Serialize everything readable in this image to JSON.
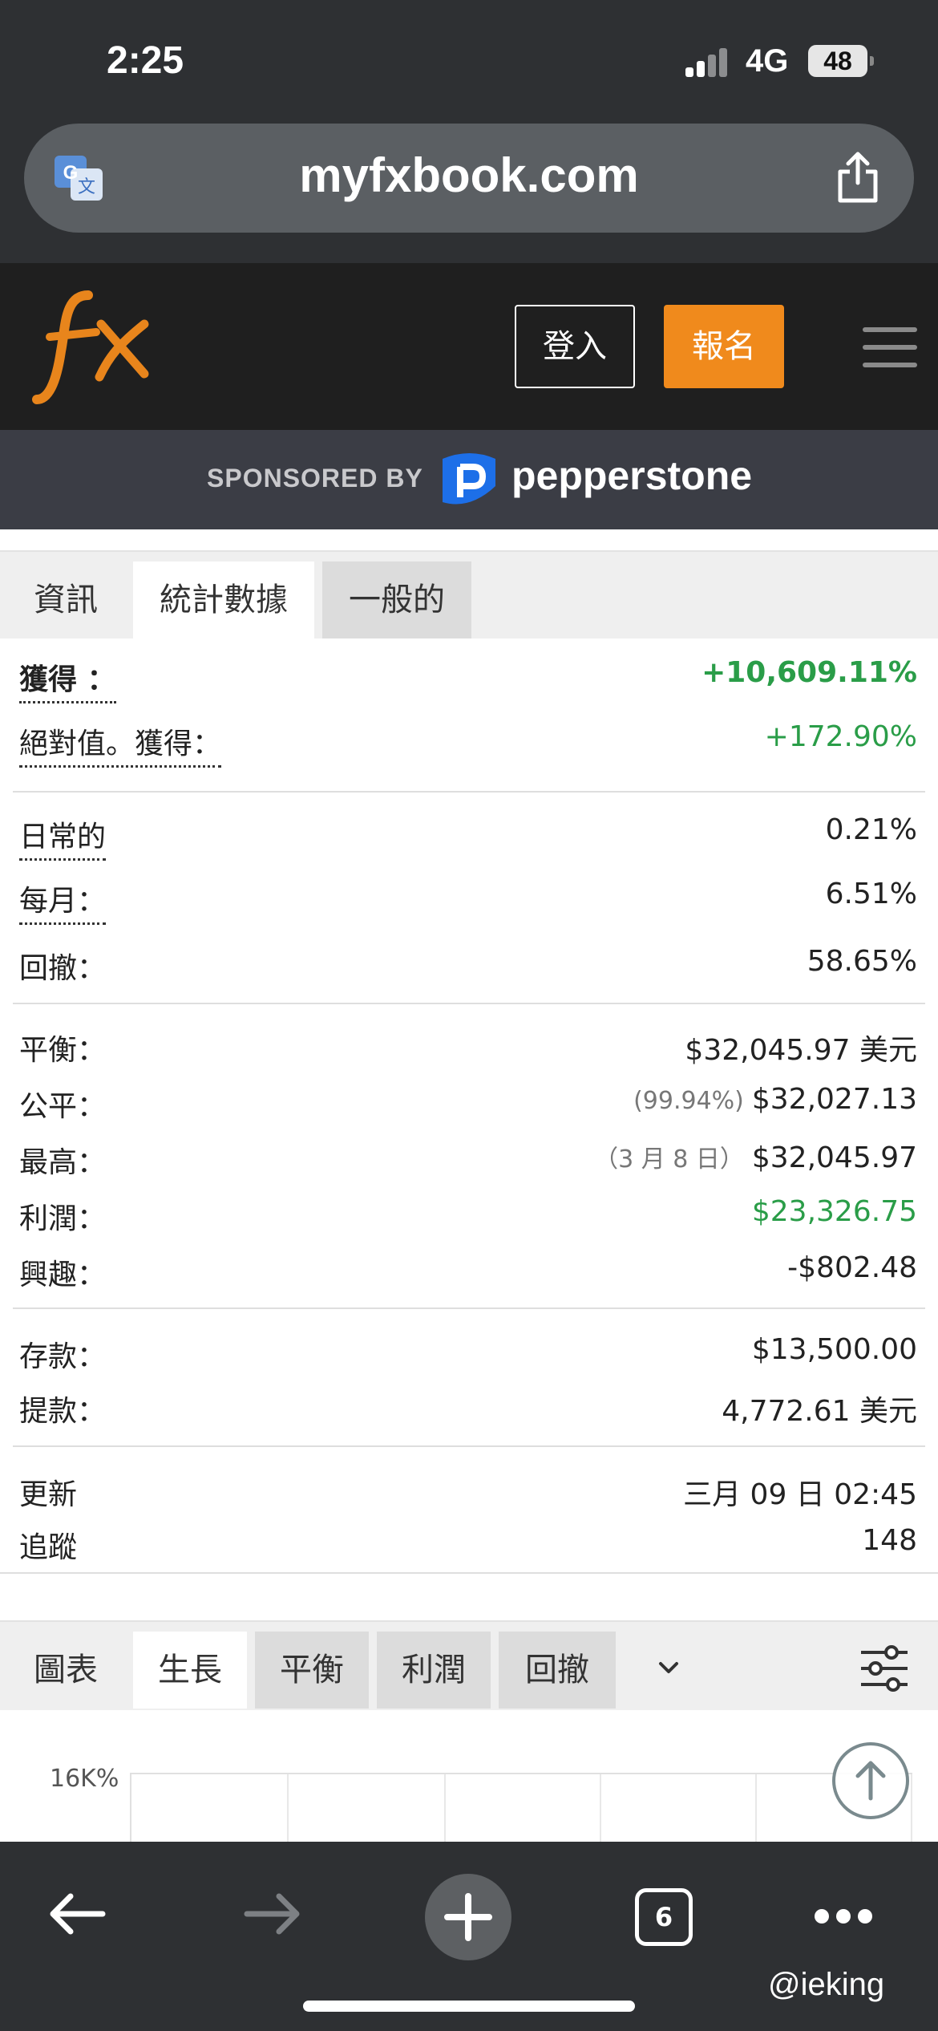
{
  "status_bar": {
    "time": "2:25",
    "network": "4G",
    "battery": "48"
  },
  "browser": {
    "url": "myfxbook.com",
    "tab_count": "6"
  },
  "site": {
    "login_label": "登入",
    "signup_label": "報名",
    "sponsor_text": "SPONSORED BY",
    "sponsor_name": "pepperstone"
  },
  "stats_tabs": [
    {
      "label": "資訊"
    },
    {
      "label": "統計數據"
    },
    {
      "label": "一般的"
    }
  ],
  "stats": {
    "gain": {
      "label": "獲得 ：",
      "value": "+10,609.11%"
    },
    "abs_gain": {
      "label": "絕對值。獲得：",
      "value": "+172.90%"
    },
    "daily": {
      "label": "日常的",
      "value": "0.21%"
    },
    "monthly": {
      "label": "每月：",
      "value": "6.51%"
    },
    "drawdown": {
      "label": "回撤：",
      "value": "58.65%"
    },
    "balance": {
      "label": "平衡：",
      "value": "$32,045.97 美元"
    },
    "equity": {
      "label": "公平：",
      "note": "(99.94%)",
      "value": "$32,027.13"
    },
    "highest": {
      "label": "最高：",
      "note": "（3 月 8 日）",
      "value": "$32,045.97"
    },
    "profit": {
      "label": "利潤：",
      "value": "$23,326.75"
    },
    "interest": {
      "label": "興趣：",
      "value": "-$802.48"
    },
    "deposits": {
      "label": "存款：",
      "value": "$13,500.00"
    },
    "withdrawals": {
      "label": "提款：",
      "value": "4,772.61 美元"
    },
    "updated": {
      "label": "更新",
      "value": "三月 09 日 02:45"
    },
    "tracking": {
      "label": "追蹤",
      "value": "148"
    }
  },
  "chart_tabs": [
    {
      "label": "圖表"
    },
    {
      "label": "生長"
    },
    {
      "label": "平衡"
    },
    {
      "label": "利潤"
    },
    {
      "label": "回撤"
    }
  ],
  "chart": {
    "y_tick": "16K%"
  },
  "watermark": "@ieking",
  "colors": {
    "accent_orange": "#f08a1c",
    "positive_green": "#2a9d48",
    "header_dark": "#1f1f1f"
  }
}
